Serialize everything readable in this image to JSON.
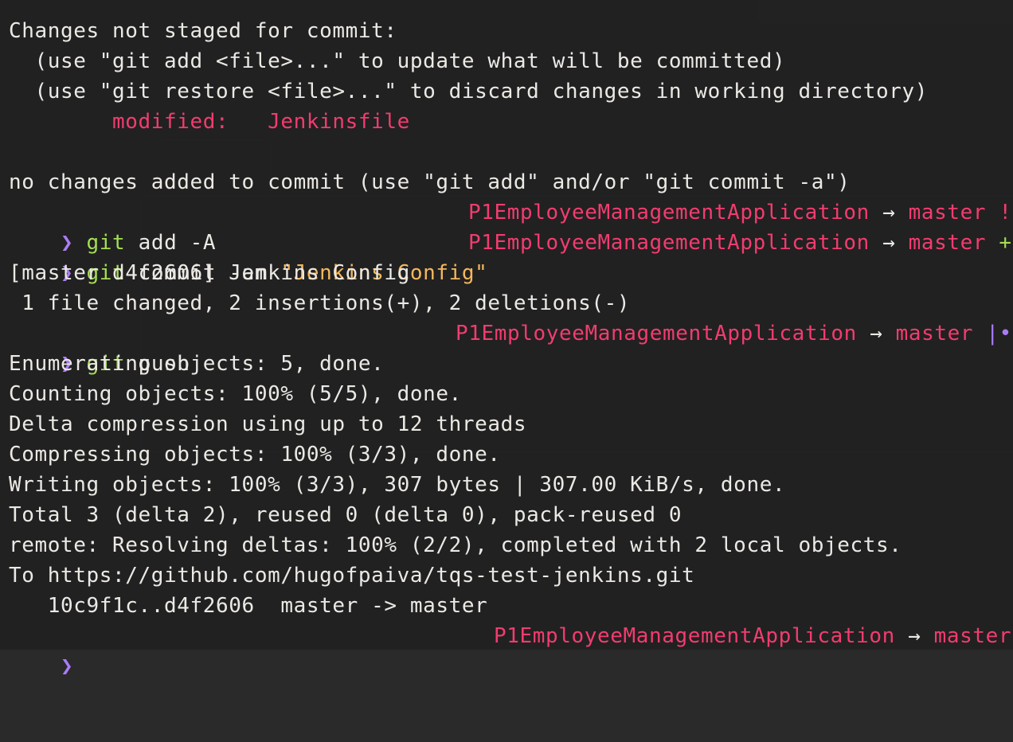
{
  "terminal": {
    "unstaged_header": "Changes not staged for commit:",
    "hint_add": "  (use \"git add <file>...\" to update what will be committed)",
    "hint_restore": "  (use \"git restore <file>...\" to discard changes in working directory)",
    "modified_label": "        modified:   Jenkinsfile",
    "no_changes": "no changes added to commit (use \"git add\" and/or \"git commit -a\")",
    "prompt_symbol": "❯",
    "cmd1": {
      "git": "git",
      "args": " add -A"
    },
    "cmd2": {
      "git": "git",
      "args": " commit -am ",
      "message": "\"Jenkins Config\""
    },
    "commit_result": "[master d4f2606] Jenkins Config",
    "commit_stats": " 1 file changed, 2 insertions(+), 2 deletions(-)",
    "cmd3": {
      "git": "git",
      "args": " push"
    },
    "push_output": [
      "Enumerating objects: 5, done.",
      "Counting objects: 100% (5/5), done.",
      "Delta compression using up to 12 threads",
      "Compressing objects: 100% (3/3), done.",
      "Writing objects: 100% (3/3), 307 bytes | 307.00 KiB/s, done.",
      "Total 3 (delta 2), reused 0 (delta 0), pack-reused 0",
      "remote: Resolving deltas: 100% (2/2), completed with 2 local objects.",
      "To https://github.com/hugofpaiva/tqs-test-jenkins.git",
      "   10c9f1c..d4f2606  master -> master"
    ],
    "status": {
      "repo": "P1EmployeeManagementApplication",
      "arrow": " → ",
      "branch": "master",
      "dirty_marker": " !",
      "staged_marker": " +",
      "ahead_marker": " |•"
    }
  },
  "colors": {
    "background": "#1f1f20",
    "text": "#ece9e4",
    "prompt": "#a97cf6",
    "git": "#a4dd52",
    "string": "#f5b85c",
    "status": "#f23c6e"
  }
}
